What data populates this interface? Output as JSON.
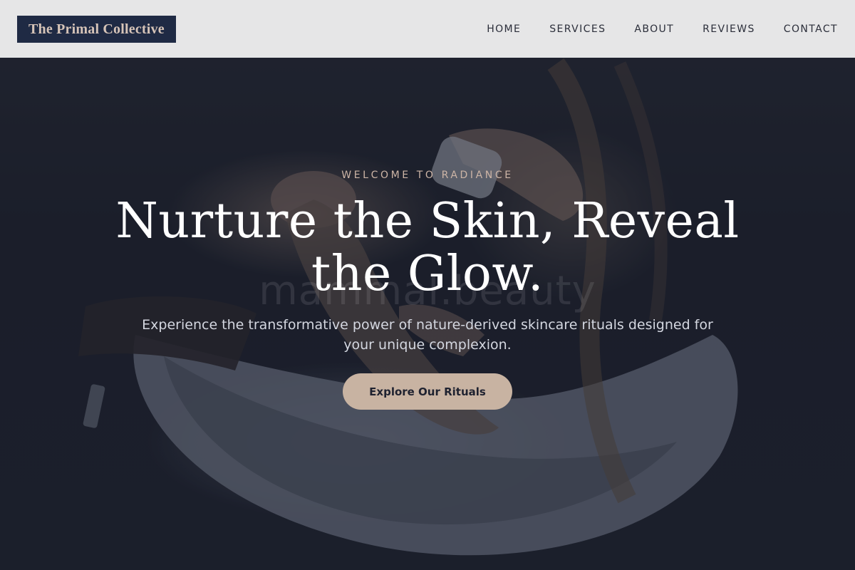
{
  "header": {
    "logo_text": "The Primal Collective",
    "nav": [
      {
        "label": "HOME"
      },
      {
        "label": "SERVICES"
      },
      {
        "label": "ABOUT"
      },
      {
        "label": "REVIEWS"
      },
      {
        "label": "CONTACT"
      }
    ]
  },
  "hero": {
    "eyebrow": "WELCOME TO RADIANCE",
    "headline": "Nurture the Skin, Reveal the Glow.",
    "subtext": "Experience the transformative power of nature-derived skincare rituals designed for your unique complexion.",
    "cta_label": "Explore Our Rituals",
    "watermark": "mammal.beauty"
  },
  "colors": {
    "header_bg": "#f2f2f3",
    "logo_bg": "#1f2a44",
    "logo_text": "#d6c4b8",
    "accent": "#c8b3a2",
    "overlay": "#161a28"
  }
}
